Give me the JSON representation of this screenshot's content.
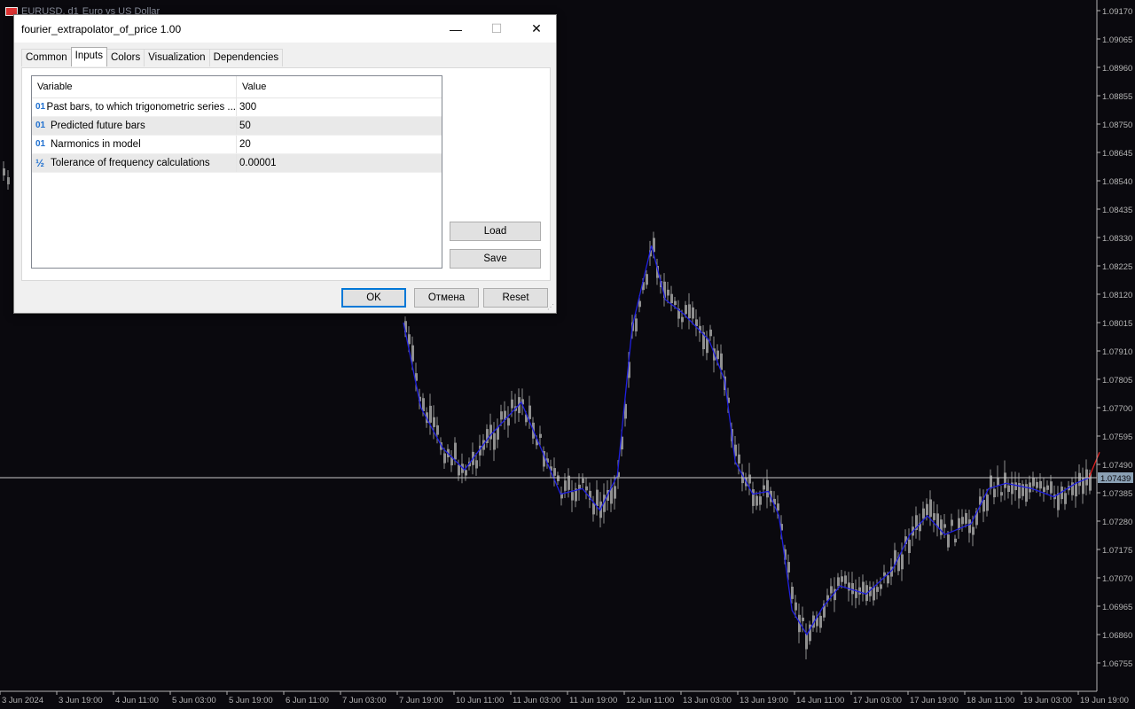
{
  "chart": {
    "symbol": "EURUSD, d1",
    "description": "Euro vs US Dollar",
    "current_price": "1.07439",
    "colors": {
      "background": "#0a090e",
      "candle": "#8f8f8f",
      "indicator_line": "#1f1fe0",
      "forecast_line": "#e02020",
      "crosshair": "#c8c8c8",
      "axis_text": "#b4b4b4",
      "price_label_bg": "#8aa0b4"
    },
    "price_axis": [
      "1.09170",
      "1.09065",
      "1.08960",
      "1.08855",
      "1.08750",
      "1.08645",
      "1.08540",
      "1.08435",
      "1.08330",
      "1.08225",
      "1.08120",
      "1.08015",
      "1.07910",
      "1.07805",
      "1.07700",
      "1.07595",
      "1.07490",
      "1.07385",
      "1.07280",
      "1.07175",
      "1.07070",
      "1.06965",
      "1.06860",
      "1.06755"
    ],
    "time_axis": [
      "3 Jun 2024",
      "3 Jun 19:00",
      "4 Jun 11:00",
      "5 Jun 03:00",
      "5 Jun 19:00",
      "6 Jun 11:00",
      "7 Jun 03:00",
      "7 Jun 19:00",
      "10 Jun 11:00",
      "11 Jun 03:00",
      "11 Jun 19:00",
      "12 Jun 11:00",
      "13 Jun 03:00",
      "13 Jun 19:00",
      "14 Jun 11:00",
      "17 Jun 03:00",
      "17 Jun 19:00",
      "18 Jun 11:00",
      "19 Jun 03:00",
      "19 Jun 19:00"
    ],
    "indicator_path": [
      [
        1.08015,
        0
      ],
      [
        1.077,
        20
      ],
      [
        1.0755,
        45
      ],
      [
        1.0747,
        70
      ],
      [
        1.076,
        100
      ],
      [
        1.0772,
        135
      ],
      [
        1.0753,
        160
      ],
      [
        1.0738,
        180
      ],
      [
        1.074,
        205
      ],
      [
        1.0732,
        225
      ],
      [
        1.0745,
        245
      ],
      [
        1.08,
        262
      ],
      [
        1.083,
        284
      ],
      [
        1.081,
        300
      ],
      [
        1.0805,
        320
      ],
      [
        1.0795,
        350
      ],
      [
        1.078,
        368
      ],
      [
        1.075,
        380
      ],
      [
        1.0738,
        400
      ],
      [
        1.0739,
        418
      ],
      [
        1.073,
        430
      ],
      [
        1.0695,
        445
      ],
      [
        1.0686,
        462
      ],
      [
        1.0696,
        480
      ],
      [
        1.0704,
        500
      ],
      [
        1.0701,
        530
      ],
      [
        1.071,
        560
      ],
      [
        1.0723,
        580
      ],
      [
        1.073,
        600
      ],
      [
        1.0723,
        620
      ],
      [
        1.0727,
        650
      ],
      [
        1.074,
        670
      ],
      [
        1.0742,
        690
      ],
      [
        1.074,
        720
      ],
      [
        1.0737,
        745
      ],
      [
        1.0742,
        770
      ],
      [
        1.0744,
        785
      ]
    ],
    "forecast_path": [
      [
        1.0744,
        0
      ],
      [
        1.0748,
        5
      ],
      [
        1.07535,
        12
      ]
    ]
  },
  "dialog": {
    "title": "fourier_extrapolator_of_price 1.00",
    "window_buttons": {
      "minimize": "—",
      "maximize": "☐",
      "close": "✕"
    },
    "tabs": [
      "Common",
      "Inputs",
      "Colors",
      "Visualization",
      "Dependencies"
    ],
    "active_tab": "Inputs",
    "columns": {
      "variable": "Variable",
      "value": "Value"
    },
    "rows": [
      {
        "icon": "01",
        "variable": "Past bars, to which trigonometric series ...",
        "value": "300"
      },
      {
        "icon": "01",
        "variable": "Predicted future bars",
        "value": "50"
      },
      {
        "icon": "01",
        "variable": "Narmonics in model",
        "value": "20"
      },
      {
        "icon": "½",
        "variable": "Tolerance of frequency calculations",
        "value": "0.00001"
      }
    ],
    "buttons": {
      "load": "Load",
      "save": "Save",
      "ok": "OK",
      "cancel": "Отмена",
      "reset": "Reset"
    }
  }
}
